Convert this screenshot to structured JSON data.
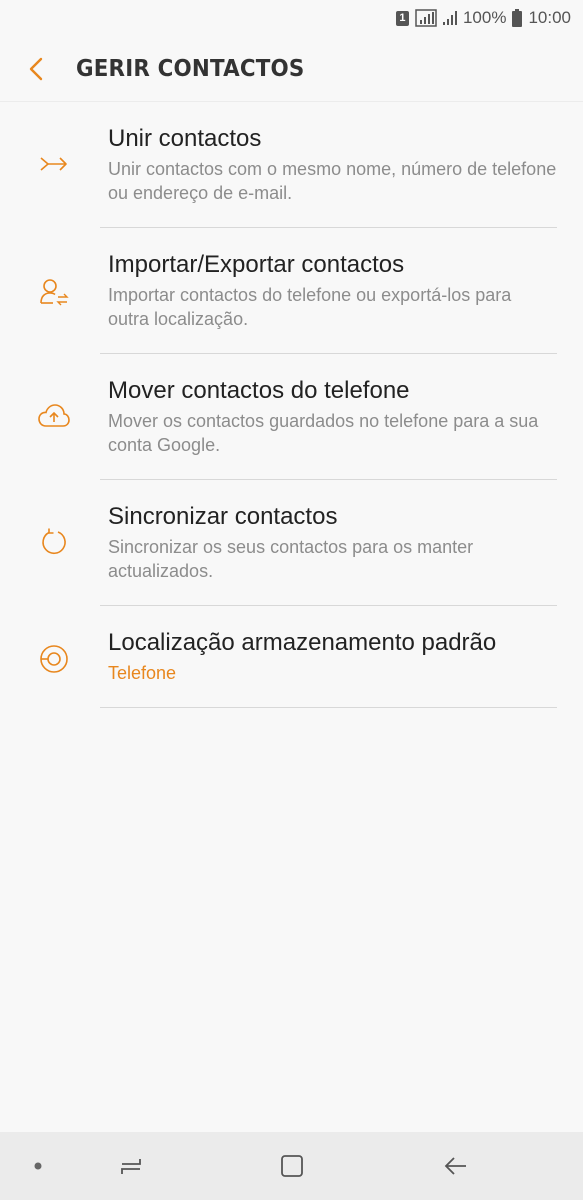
{
  "status_bar": {
    "sim_label": "1",
    "battery_text": "100%",
    "time": "10:00"
  },
  "header": {
    "title": "GERIR CONTACTOS",
    "back_icon": "chevron-left-icon"
  },
  "accent_color": "#e8871e",
  "items": [
    {
      "title": "Unir contactos",
      "subtitle": "Unir contactos com o mesmo nome, número de telefone ou endereço de e-mail.",
      "icon": "merge-icon"
    },
    {
      "title": "Importar/Exportar contactos",
      "subtitle": "Importar contactos do telefone ou exportá-los para outra localização.",
      "icon": "import-export-icon"
    },
    {
      "title": "Mover contactos do telefone",
      "subtitle": "Mover os contactos guardados no telefone para a sua conta Google.",
      "icon": "cloud-upload-icon"
    },
    {
      "title": "Sincronizar contactos",
      "subtitle": "Sincronizar os seus contactos para os manter actualizados.",
      "icon": "sync-icon"
    },
    {
      "title": "Localização armazenamento padrão",
      "subtitle": "Telefone",
      "icon": "storage-location-icon"
    }
  ],
  "nav_bar": {
    "buttons": [
      "dot-icon",
      "recents-icon",
      "home-icon",
      "back-icon"
    ]
  }
}
